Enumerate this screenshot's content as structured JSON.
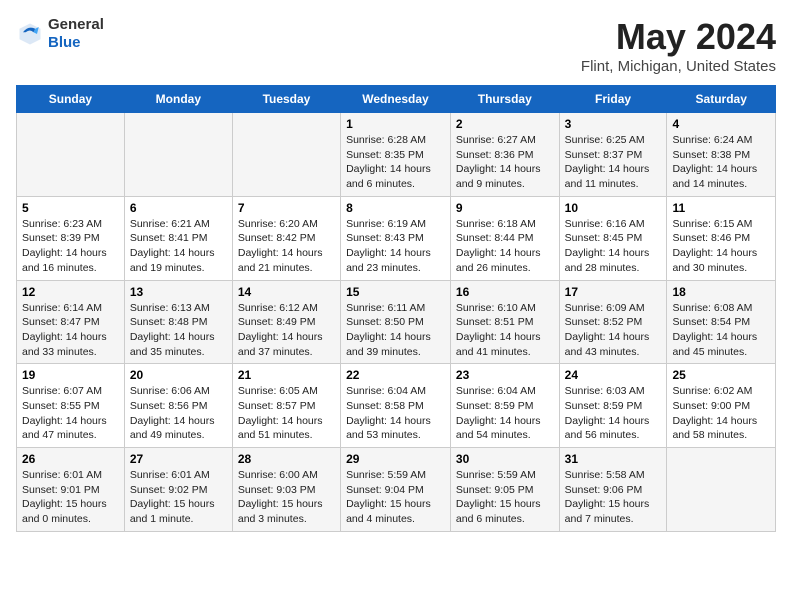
{
  "header": {
    "logo_general": "General",
    "logo_blue": "Blue",
    "main_title": "May 2024",
    "subtitle": "Flint, Michigan, United States"
  },
  "days_of_week": [
    "Sunday",
    "Monday",
    "Tuesday",
    "Wednesday",
    "Thursday",
    "Friday",
    "Saturday"
  ],
  "weeks": [
    [
      {
        "day": "",
        "info": ""
      },
      {
        "day": "",
        "info": ""
      },
      {
        "day": "",
        "info": ""
      },
      {
        "day": "1",
        "info": "Sunrise: 6:28 AM\nSunset: 8:35 PM\nDaylight: 14 hours\nand 6 minutes."
      },
      {
        "day": "2",
        "info": "Sunrise: 6:27 AM\nSunset: 8:36 PM\nDaylight: 14 hours\nand 9 minutes."
      },
      {
        "day": "3",
        "info": "Sunrise: 6:25 AM\nSunset: 8:37 PM\nDaylight: 14 hours\nand 11 minutes."
      },
      {
        "day": "4",
        "info": "Sunrise: 6:24 AM\nSunset: 8:38 PM\nDaylight: 14 hours\nand 14 minutes."
      }
    ],
    [
      {
        "day": "5",
        "info": "Sunrise: 6:23 AM\nSunset: 8:39 PM\nDaylight: 14 hours\nand 16 minutes."
      },
      {
        "day": "6",
        "info": "Sunrise: 6:21 AM\nSunset: 8:41 PM\nDaylight: 14 hours\nand 19 minutes."
      },
      {
        "day": "7",
        "info": "Sunrise: 6:20 AM\nSunset: 8:42 PM\nDaylight: 14 hours\nand 21 minutes."
      },
      {
        "day": "8",
        "info": "Sunrise: 6:19 AM\nSunset: 8:43 PM\nDaylight: 14 hours\nand 23 minutes."
      },
      {
        "day": "9",
        "info": "Sunrise: 6:18 AM\nSunset: 8:44 PM\nDaylight: 14 hours\nand 26 minutes."
      },
      {
        "day": "10",
        "info": "Sunrise: 6:16 AM\nSunset: 8:45 PM\nDaylight: 14 hours\nand 28 minutes."
      },
      {
        "day": "11",
        "info": "Sunrise: 6:15 AM\nSunset: 8:46 PM\nDaylight: 14 hours\nand 30 minutes."
      }
    ],
    [
      {
        "day": "12",
        "info": "Sunrise: 6:14 AM\nSunset: 8:47 PM\nDaylight: 14 hours\nand 33 minutes."
      },
      {
        "day": "13",
        "info": "Sunrise: 6:13 AM\nSunset: 8:48 PM\nDaylight: 14 hours\nand 35 minutes."
      },
      {
        "day": "14",
        "info": "Sunrise: 6:12 AM\nSunset: 8:49 PM\nDaylight: 14 hours\nand 37 minutes."
      },
      {
        "day": "15",
        "info": "Sunrise: 6:11 AM\nSunset: 8:50 PM\nDaylight: 14 hours\nand 39 minutes."
      },
      {
        "day": "16",
        "info": "Sunrise: 6:10 AM\nSunset: 8:51 PM\nDaylight: 14 hours\nand 41 minutes."
      },
      {
        "day": "17",
        "info": "Sunrise: 6:09 AM\nSunset: 8:52 PM\nDaylight: 14 hours\nand 43 minutes."
      },
      {
        "day": "18",
        "info": "Sunrise: 6:08 AM\nSunset: 8:54 PM\nDaylight: 14 hours\nand 45 minutes."
      }
    ],
    [
      {
        "day": "19",
        "info": "Sunrise: 6:07 AM\nSunset: 8:55 PM\nDaylight: 14 hours\nand 47 minutes."
      },
      {
        "day": "20",
        "info": "Sunrise: 6:06 AM\nSunset: 8:56 PM\nDaylight: 14 hours\nand 49 minutes."
      },
      {
        "day": "21",
        "info": "Sunrise: 6:05 AM\nSunset: 8:57 PM\nDaylight: 14 hours\nand 51 minutes."
      },
      {
        "day": "22",
        "info": "Sunrise: 6:04 AM\nSunset: 8:58 PM\nDaylight: 14 hours\nand 53 minutes."
      },
      {
        "day": "23",
        "info": "Sunrise: 6:04 AM\nSunset: 8:59 PM\nDaylight: 14 hours\nand 54 minutes."
      },
      {
        "day": "24",
        "info": "Sunrise: 6:03 AM\nSunset: 8:59 PM\nDaylight: 14 hours\nand 56 minutes."
      },
      {
        "day": "25",
        "info": "Sunrise: 6:02 AM\nSunset: 9:00 PM\nDaylight: 14 hours\nand 58 minutes."
      }
    ],
    [
      {
        "day": "26",
        "info": "Sunrise: 6:01 AM\nSunset: 9:01 PM\nDaylight: 15 hours\nand 0 minutes."
      },
      {
        "day": "27",
        "info": "Sunrise: 6:01 AM\nSunset: 9:02 PM\nDaylight: 15 hours\nand 1 minute."
      },
      {
        "day": "28",
        "info": "Sunrise: 6:00 AM\nSunset: 9:03 PM\nDaylight: 15 hours\nand 3 minutes."
      },
      {
        "day": "29",
        "info": "Sunrise: 5:59 AM\nSunset: 9:04 PM\nDaylight: 15 hours\nand 4 minutes."
      },
      {
        "day": "30",
        "info": "Sunrise: 5:59 AM\nSunset: 9:05 PM\nDaylight: 15 hours\nand 6 minutes."
      },
      {
        "day": "31",
        "info": "Sunrise: 5:58 AM\nSunset: 9:06 PM\nDaylight: 15 hours\nand 7 minutes."
      },
      {
        "day": "",
        "info": ""
      }
    ]
  ]
}
